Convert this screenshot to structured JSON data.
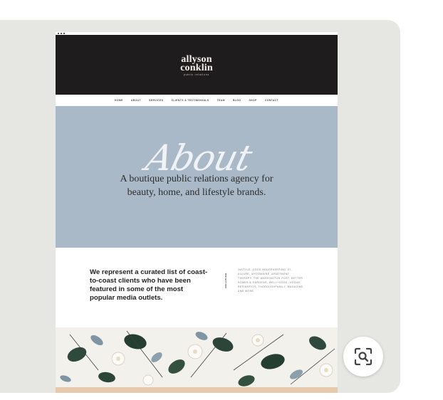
{
  "site": {
    "logo": {
      "line1": "allyson",
      "line2": "conklin",
      "line3": "public relations"
    },
    "nav": [
      "HOME",
      "ABOUT",
      "SERVICES",
      "CLIENTS & TESTIMONIALS",
      "TEAM",
      "BLOG",
      "SHOP",
      "CONTACT"
    ],
    "hero": {
      "script_title": "About",
      "tagline_line1": "A boutique public relations agency for",
      "tagline_line2": "beauty, home, and lifestyle brands."
    },
    "about": {
      "lead": "We represent a curated list of coast-to-coast clients who have been featured in some of the most popular media outlets.",
      "divider_label": "INCLUDING",
      "list": "INSTYLE, GOOD HOUSEKEEPING, E!, ALLURE, MYDOMAINE, APARTMENT THERAPY, THE WASHINGTON POST, BETTER HOMES & GARDENS, WELL+GOOD, VOGUE, REFINERY29, THOROUGHFAMILY, MAGAZINE, AND MORE."
    }
  },
  "colors": {
    "card_bg": "#e6e7e2",
    "header_bg": "#1f1c1d",
    "hero_bg": "#a9b9c8",
    "floral_bg": "#f3f1ec",
    "peach": "#e7c9ad"
  },
  "icons": {
    "lens_button": "visual-search-icon"
  }
}
